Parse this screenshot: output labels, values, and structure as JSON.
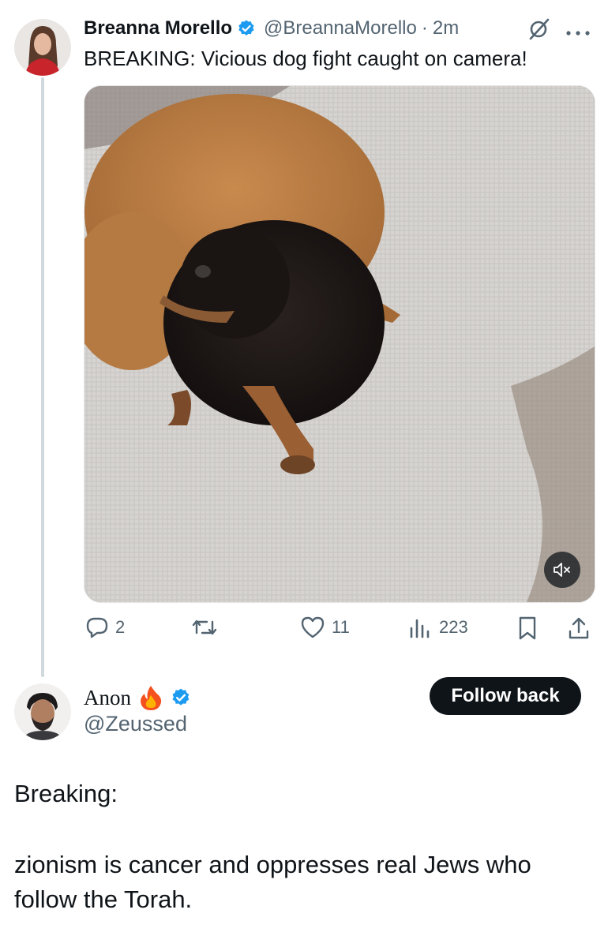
{
  "tweet": {
    "author_name": "Breanna Morello",
    "author_handle": "@BreannaMorello",
    "separator": "·",
    "time": "2m",
    "text": "BREAKING: Vicious dog fight caught on camera!",
    "actions": {
      "replies": "2",
      "likes": "11",
      "views": "223"
    }
  },
  "reply": {
    "author_name": "Anon",
    "author_handle": "@Zeussed",
    "follow_label": "Follow back",
    "line1": "Breaking:",
    "line2": "zionism is cancer and oppresses real Jews who follow the Torah."
  },
  "colors": {
    "verified": "#1d9bf0",
    "text": "#0f1419",
    "secondary": "#536471",
    "follow_bg": "#0f1419"
  },
  "icons": [
    "reply-icon",
    "retweet-icon",
    "like-icon",
    "views-icon",
    "bookmark-icon",
    "share-icon",
    "mute-icon",
    "grok-icon",
    "more-icon",
    "verified-badge-icon",
    "fire-icon"
  ]
}
